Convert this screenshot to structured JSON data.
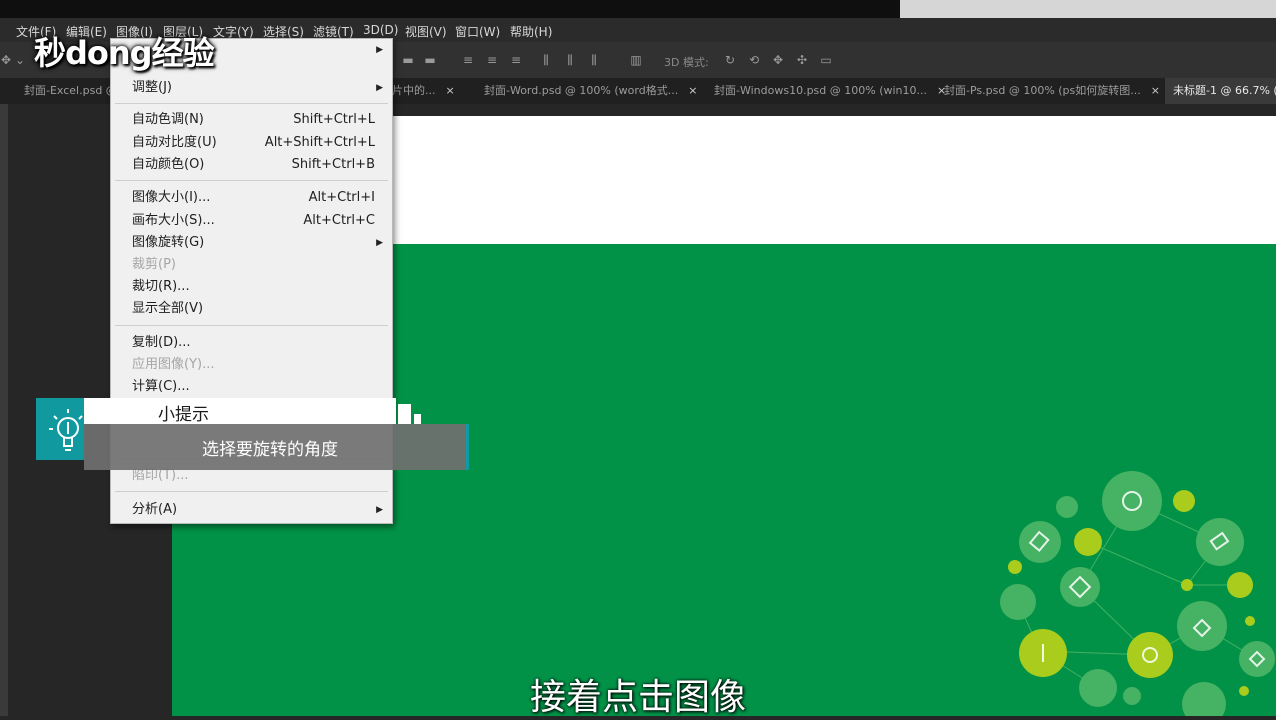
{
  "watermark": {
    "logo": "秒dong经验"
  },
  "menubar": {
    "items": [
      "文件(F)",
      "编辑(E)",
      "图像(I)",
      "图层(L)",
      "文字(Y)",
      "选择(S)",
      "滤镜(T)",
      "3D(D)",
      "视图(V)",
      "窗口(W)",
      "帮助(H)"
    ]
  },
  "options_bar": {
    "mode_label": "3D 模式:"
  },
  "tabs": [
    {
      "label": "封面-Excel.psd @"
    },
    {
      "label": "片中的..."
    },
    {
      "label": "封面-Word.psd @ 100% (word格式..."
    },
    {
      "label": "封面-Windows10.psd @ 100% (win10..."
    },
    {
      "label": "封面-Ps.psd @ 100% (ps如何旋转图..."
    },
    {
      "label": "未标题-1 @ 66.7% (",
      "active": true
    }
  ],
  "image_menu": {
    "items": [
      {
        "label": "调整(J)",
        "submenu": true
      },
      {
        "label": "自动色调(N)",
        "shortcut": "Shift+Ctrl+L"
      },
      {
        "label": "自动对比度(U)",
        "shortcut": "Alt+Shift+Ctrl+L"
      },
      {
        "label": "自动颜色(O)",
        "shortcut": "Shift+Ctrl+B"
      },
      {
        "label": "图像大小(I)...",
        "shortcut": "Alt+Ctrl+I"
      },
      {
        "label": "画布大小(S)...",
        "shortcut": "Alt+Ctrl+C"
      },
      {
        "label": "图像旋转(G)",
        "submenu": true
      },
      {
        "label": "裁剪(P)",
        "disabled": true
      },
      {
        "label": "裁切(R)..."
      },
      {
        "label": "显示全部(V)"
      },
      {
        "label": "复制(D)..."
      },
      {
        "label": "应用图像(Y)...",
        "disabled": true
      },
      {
        "label": "计算(C)..."
      },
      {
        "label": "陷印(T)...",
        "disabled": true
      },
      {
        "label": "分析(A)",
        "submenu": true
      }
    ]
  },
  "tip": {
    "title": "小提示",
    "text": "选择要旋转的角度"
  },
  "subtitle": "接着点击图像",
  "colors": {
    "canvas_green": "#029247",
    "tip_teal": "#109aa0",
    "menu_bg": "#f0f0f0"
  }
}
